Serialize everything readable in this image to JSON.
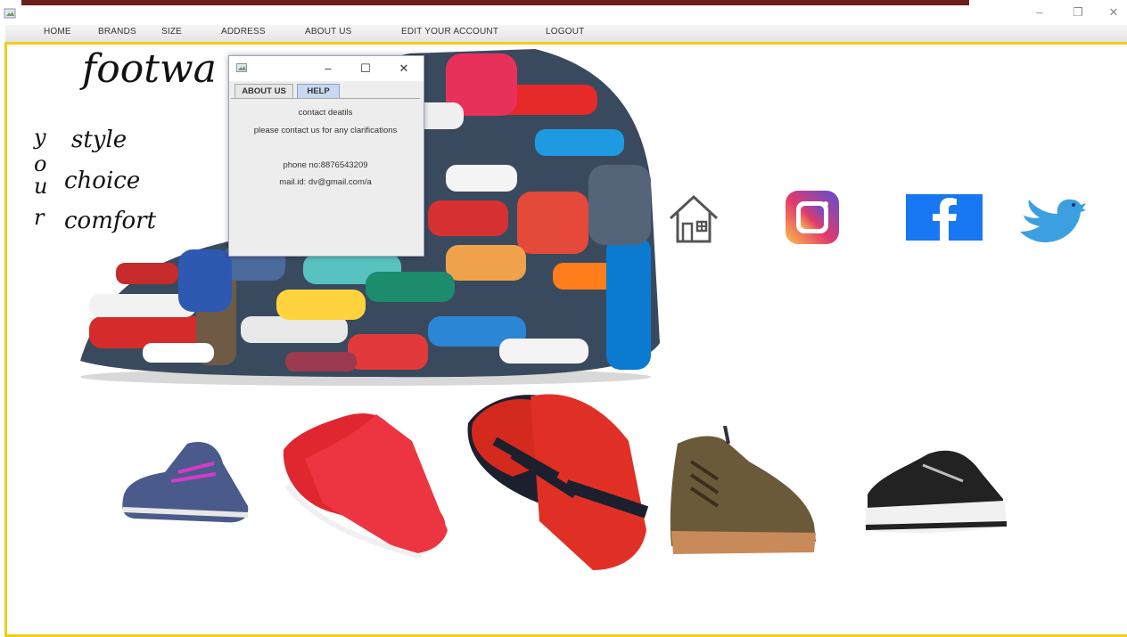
{
  "window": {
    "minimize_glyph": "–",
    "restore_glyph": "❐",
    "close_glyph": "✕"
  },
  "menu": [
    {
      "label": "HOME"
    },
    {
      "label": "BRANDS"
    },
    {
      "label": "SIZE"
    },
    {
      "label": "ADDRESS"
    },
    {
      "label": "ABOUT US"
    },
    {
      "label": "EDIT YOUR ACCOUNT"
    },
    {
      "label": "LOGOUT"
    }
  ],
  "brand": {
    "name": "footwa",
    "your_letters": [
      "y",
      "o",
      "u",
      "r"
    ],
    "taglines": [
      "style",
      "choice",
      "comfort"
    ]
  },
  "dialog": {
    "minimize_glyph": "–",
    "maximize_glyph": "☐",
    "close_glyph": "✕",
    "tabs": [
      {
        "label": "ABOUT US",
        "active": false
      },
      {
        "label": "HELP",
        "active": true
      }
    ],
    "lines": [
      "contact deatils",
      "please contact us for any clarifications",
      "phone no:8876543209",
      "mail.id: dv@gmail.com/a"
    ]
  },
  "social": [
    {
      "icon": "home-icon"
    },
    {
      "icon": "instagram-icon"
    },
    {
      "icon": "facebook-icon"
    },
    {
      "icon": "twitter-icon"
    }
  ],
  "products": [
    {
      "icon": "blue-sneaker-icon",
      "color": "#4a5a8a"
    },
    {
      "icon": "red-sneaker-icon",
      "color": "#e0262e"
    },
    {
      "icon": "red-black-sport-shoe-icon",
      "color": "#d42a1e"
    },
    {
      "icon": "brown-boot-icon",
      "color": "#6b5a3a"
    },
    {
      "icon": "black-white-sneaker-icon",
      "color": "#222222"
    }
  ],
  "colors": {
    "frame_yellow": "#f2cd1e",
    "topbar_red": "#6b1f1a",
    "facebook_blue": "#1877f2",
    "twitter_blue": "#3b9fe0"
  }
}
